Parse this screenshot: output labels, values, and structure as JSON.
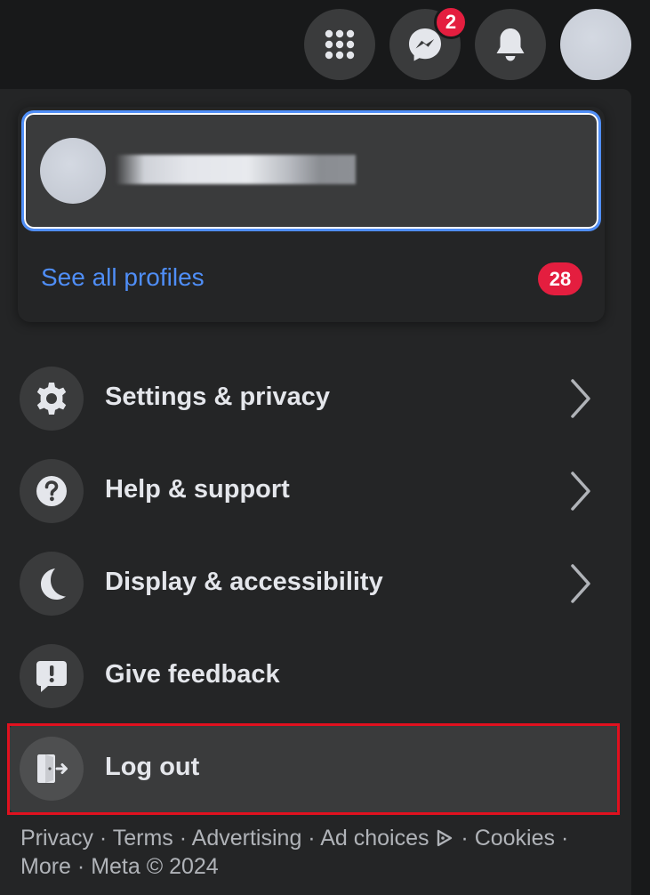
{
  "topbar": {
    "menu_icon": "grid-menu-icon",
    "messenger_icon": "messenger-icon",
    "messenger_badge": "2",
    "notifications_icon": "bell-icon",
    "avatar_icon": "avatar"
  },
  "profile": {
    "see_all_label": "See all profiles",
    "badge_count": "28"
  },
  "menu": {
    "items": [
      {
        "label": "Settings & privacy",
        "icon": "gear-icon",
        "has_chevron": true
      },
      {
        "label": "Help & support",
        "icon": "question-icon",
        "has_chevron": true
      },
      {
        "label": "Display & accessibility",
        "icon": "moon-icon",
        "has_chevron": true
      },
      {
        "label": "Give feedback",
        "icon": "feedback-icon",
        "has_chevron": false
      },
      {
        "label": "Log out",
        "icon": "logout-icon",
        "has_chevron": false
      }
    ]
  },
  "footer": {
    "privacy": "Privacy",
    "terms": "Terms",
    "advertising": "Advertising",
    "ad_choices": "Ad choices",
    "cookies": "Cookies",
    "more": "More",
    "meta": "Meta © 2024",
    "separator": "·"
  },
  "colors": {
    "background": "#18191a",
    "panel": "#242526",
    "icon_bg": "#3a3b3c",
    "accent_blue": "#4f8ef7",
    "badge_red": "#e41e3f",
    "text_primary": "#e4e6eb",
    "text_secondary": "#b0b3b8",
    "highlight_red": "#e0111f"
  }
}
